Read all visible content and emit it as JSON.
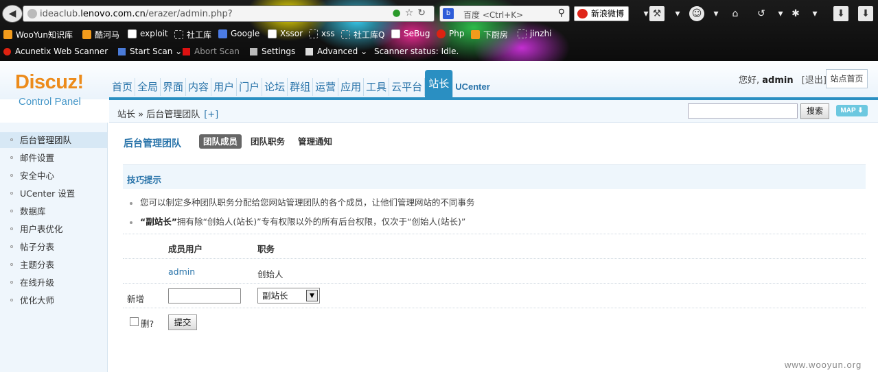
{
  "browser": {
    "url_domain": "ideaclub.",
    "url_host_bold": "lenovo.com.cn",
    "url_path": "/erazer/admin.php?",
    "search_placeholder": "百度 <Ctrl+K>",
    "weibo_label": "新浪微博",
    "bookmarks": [
      "WooYun知识库",
      "酷河马",
      "exploit",
      "社工库",
      "Google",
      "Xssor",
      "xss",
      "社工库Q",
      "SeBug",
      "Php",
      "下厨房",
      "jinzhi"
    ],
    "scanner": {
      "name": "Acunetix Web Scanner",
      "start": "Start Scan",
      "abort": "Abort Scan",
      "settings": "Settings",
      "advanced": "Advanced",
      "status": "Scanner status: Idle."
    }
  },
  "header": {
    "logo": "Discuz!",
    "logo_sub": "Control Panel",
    "nav": [
      "首页",
      "全局",
      "界面",
      "内容",
      "用户",
      "门户",
      "论坛",
      "群组",
      "运营",
      "应用",
      "工具",
      "云平台",
      "站长",
      "UCenter"
    ],
    "greeting_prefix": "您好,",
    "username": "admin",
    "logout": "[退出]",
    "site_home": "站点首页"
  },
  "subbar": {
    "breadcrumb": "站长 » 后台管理团队",
    "plus": "[+]",
    "search_button": "搜索",
    "map_label": "MAP ⬇"
  },
  "sidebar": {
    "items": [
      "后台管理团队",
      "邮件设置",
      "安全中心",
      "UCenter 设置",
      "数据库",
      "用户表优化",
      "帖子分表",
      "主题分表",
      "在线升级",
      "优化大师"
    ]
  },
  "main": {
    "title": "后台管理团队",
    "tabs": [
      "团队成员",
      "团队职务",
      "管理通知"
    ],
    "tips_title": "技巧提示",
    "tip1": "您可以制定多种团队职务分配给您网站管理团队的各个成员，让他们管理网站的不同事务",
    "tip2_bold": "“副站长”",
    "tip2_rest": "拥有除“创始人(站长)”专有权限以外的所有后台权限，仅次于“创始人(站长)”",
    "col_member": "成员用户",
    "col_role": "职务",
    "row_user": "admin",
    "row_role": "创始人",
    "new_label": "新增",
    "select_value": "副站长",
    "delete_label": "删?",
    "submit": "提交"
  },
  "watermark": "www.wooyun.org"
}
